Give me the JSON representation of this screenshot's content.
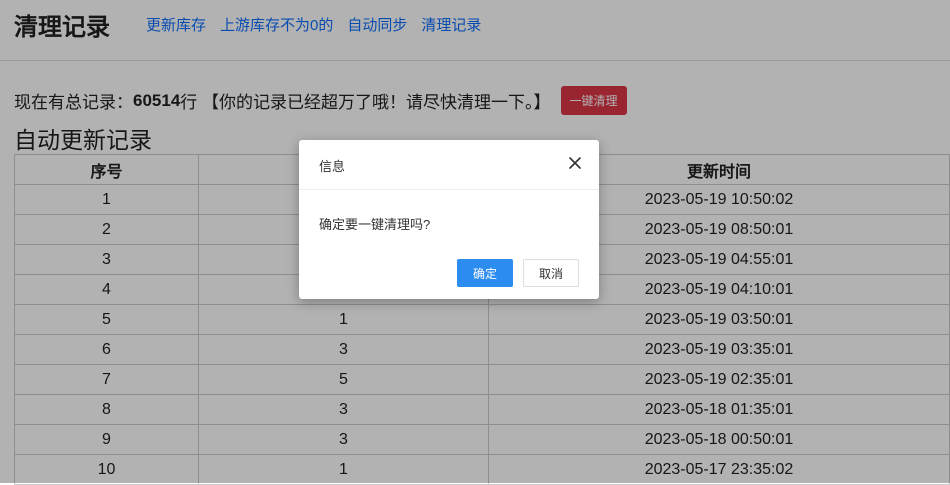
{
  "header": {
    "logo": "清理记录",
    "nav": [
      "更新库存",
      "上游库存不为0的",
      "自动同步",
      "清理记录"
    ]
  },
  "summary": {
    "prefix": "现在有总记录：",
    "count": "60514",
    "suffix": "行 【你的记录已经超万了哦！请尽快清理一下。】",
    "button": "一键清理"
  },
  "section_title": "自动更新记录",
  "table": {
    "headers": [
      "序号",
      "",
      "更新时间"
    ],
    "rows": [
      [
        "1",
        "",
        "2023-05-19 10:50:02"
      ],
      [
        "2",
        "",
        "2023-05-19 08:50:01"
      ],
      [
        "3",
        "",
        "2023-05-19 04:55:01"
      ],
      [
        "4",
        "",
        "2023-05-19 04:10:01"
      ],
      [
        "5",
        "1",
        "2023-05-19 03:50:01"
      ],
      [
        "6",
        "3",
        "2023-05-19 03:35:01"
      ],
      [
        "7",
        "5",
        "2023-05-19 02:35:01"
      ],
      [
        "8",
        "3",
        "2023-05-18 01:35:01"
      ],
      [
        "9",
        "3",
        "2023-05-18 00:50:01"
      ],
      [
        "10",
        "1",
        "2023-05-17 23:35:02"
      ]
    ]
  },
  "modal": {
    "title": "信息",
    "message": "确定要一键清理吗?",
    "confirm": "确定",
    "cancel": "取消"
  },
  "colors": {
    "link": "#0d6efd",
    "danger": "#dc3545",
    "primary": "#2d8cf0",
    "overlay": "rgba(0,0,0,0.30)"
  }
}
